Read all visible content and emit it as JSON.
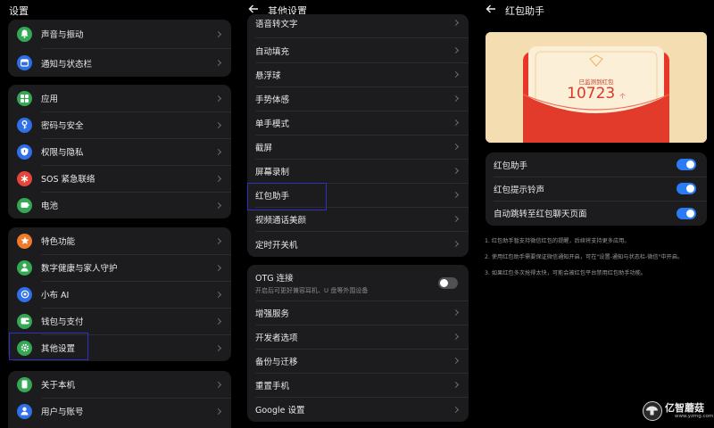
{
  "panel_settings": {
    "title": "设置",
    "items": [
      {
        "label": "声音与振动",
        "icon": "bell-icon",
        "color": "#34a853"
      },
      {
        "label": "通知与状态栏",
        "icon": "notification-icon",
        "color": "#2f6fe8"
      },
      {
        "label": "应用",
        "icon": "apps-grid-icon",
        "color": "#34a853"
      },
      {
        "label": "密码与安全",
        "icon": "key-icon",
        "color": "#2f6fe8"
      },
      {
        "label": "权限与隐私",
        "icon": "shield-icon",
        "color": "#2f6fe8"
      },
      {
        "label": "SOS 紧急联络",
        "icon": "asterisk-icon",
        "color": "#e5453a"
      },
      {
        "label": "电池",
        "icon": "battery-icon",
        "color": "#34a853"
      },
      {
        "label": "特色功能",
        "icon": "star-icon",
        "color": "#ee7a2c"
      },
      {
        "label": "数字健康与家人守护",
        "icon": "person-shield-icon",
        "color": "#34a853"
      },
      {
        "label": "小布 AI",
        "icon": "ai-icon",
        "color": "#2f6fe8"
      },
      {
        "label": "钱包与支付",
        "icon": "wallet-icon",
        "color": "#34a853"
      },
      {
        "label": "其他设置",
        "icon": "gear-icon",
        "color": "#34a853"
      },
      {
        "label": "关于本机",
        "icon": "phone-icon",
        "color": "#34a853"
      },
      {
        "label": "用户与账号",
        "icon": "user-icon",
        "color": "#2f6fe8"
      }
    ]
  },
  "panel_other": {
    "title": "其他设置",
    "items": [
      {
        "label": "语音转文字"
      },
      {
        "label": "自动填充"
      },
      {
        "label": "悬浮球"
      },
      {
        "label": "手势体感"
      },
      {
        "label": "单手模式"
      },
      {
        "label": "截屏"
      },
      {
        "label": "屏幕录制"
      },
      {
        "label": "红包助手"
      },
      {
        "label": "视频通话美颜"
      },
      {
        "label": "定时开关机"
      },
      {
        "label": "OTG 连接",
        "sub": "开启后可更好兼容耳机、U 盘等外围设备"
      },
      {
        "label": "增强服务"
      },
      {
        "label": "开发者选项"
      },
      {
        "label": "备份与迁移"
      },
      {
        "label": "重置手机"
      },
      {
        "label": "Google 设置"
      }
    ]
  },
  "panel_hongbao": {
    "title": "红包助手",
    "banner": {
      "caption": "已监测到红包",
      "count": "10723",
      "unit": "个"
    },
    "toggles": [
      {
        "label": "红包助手",
        "on": true
      },
      {
        "label": "红包提示铃声",
        "on": true
      },
      {
        "label": "自动跳转至红包聊天页面",
        "on": true
      }
    ],
    "notes": [
      "1. 红包助手暂支持微信红包的提醒，后续将支持更多应用。",
      "2. 使用红包助手需要保证微信通知开启，可在\"设置-通知与状态栏-微信\"中开启。",
      "3. 如果红包多次抢得太快，可能会被红包平台禁用红包助手功能。"
    ]
  },
  "watermark": {
    "name": "亿智蘑菇",
    "url": "www.yzmg.com"
  }
}
